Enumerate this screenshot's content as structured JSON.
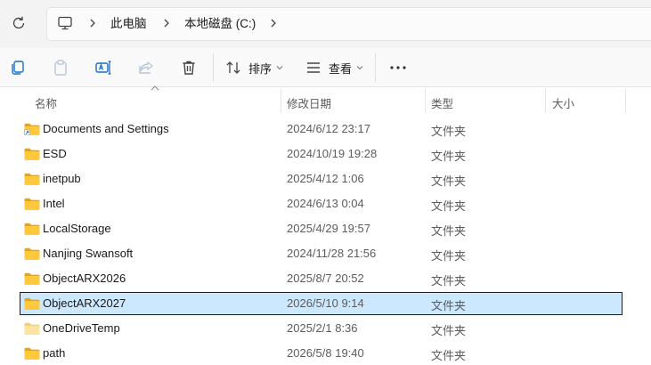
{
  "address": {
    "crumbs": [
      "此电脑",
      "本地磁盘 (C:)"
    ]
  },
  "toolbar": {
    "sort_label": "排序",
    "view_label": "查看"
  },
  "columns": {
    "name": "名称",
    "modified": "修改日期",
    "type": "类型",
    "size": "大小"
  },
  "files": [
    {
      "name": "Documents and Settings",
      "modified": "2024/6/12 23:17",
      "type": "文件夹",
      "size": "",
      "shortcut": true
    },
    {
      "name": "ESD",
      "modified": "2024/10/19 19:28",
      "type": "文件夹",
      "size": ""
    },
    {
      "name": "inetpub",
      "modified": "2025/4/12 1:06",
      "type": "文件夹",
      "size": ""
    },
    {
      "name": "Intel",
      "modified": "2024/6/13 0:04",
      "type": "文件夹",
      "size": ""
    },
    {
      "name": "LocalStorage",
      "modified": "2025/4/29 19:57",
      "type": "文件夹",
      "size": ""
    },
    {
      "name": "Nanjing Swansoft",
      "modified": "2024/11/28 21:56",
      "type": "文件夹",
      "size": ""
    },
    {
      "name": "ObjectARX2026",
      "modified": "2025/8/7 20:52",
      "type": "文件夹",
      "size": ""
    },
    {
      "name": "ObjectARX2027",
      "modified": "2026/5/10 9:14",
      "type": "文件夹",
      "size": "",
      "selected": true
    },
    {
      "name": "OneDriveTemp",
      "modified": "2025/2/1 8:36",
      "type": "文件夹",
      "size": "",
      "faded": true
    },
    {
      "name": "path",
      "modified": "2026/5/8 19:40",
      "type": "文件夹",
      "size": ""
    }
  ],
  "colors": {
    "selection": "#cce8ff",
    "folder": "#ffc83d",
    "folder_faded": "#fde3a0"
  }
}
